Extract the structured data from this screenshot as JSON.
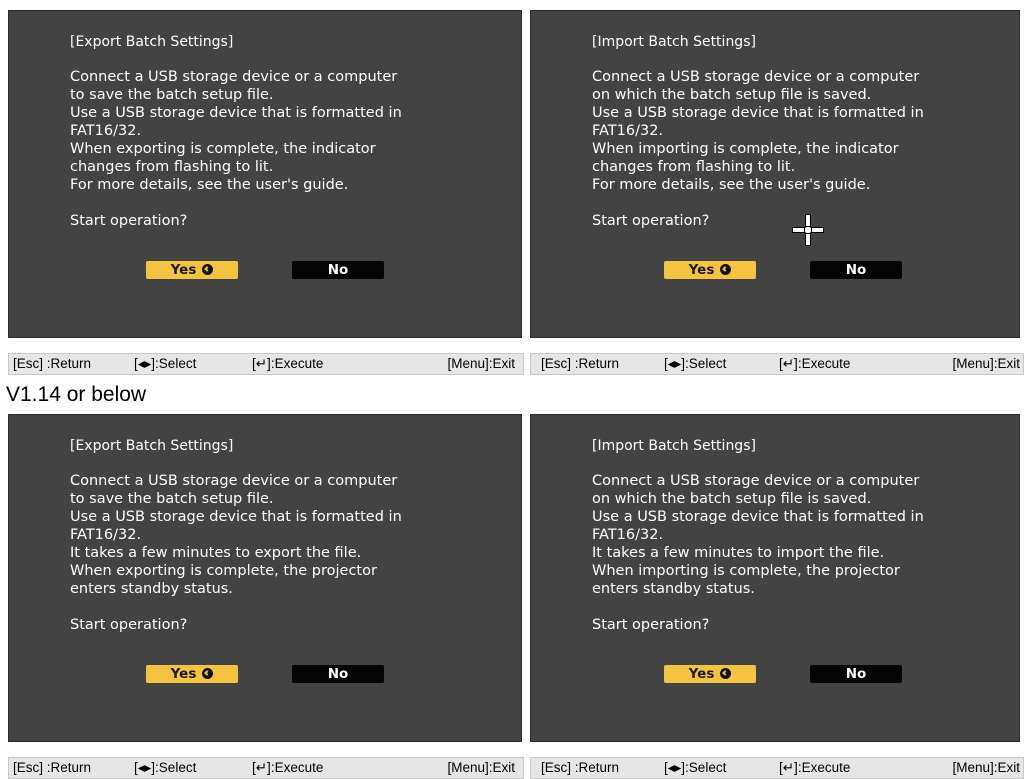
{
  "version_label": "V1.14 or below",
  "panels": {
    "top_left": {
      "title": "[Export Batch Settings]",
      "lines": [
        "Connect a USB storage device or a computer",
        "to save the batch setup file.",
        "Use a USB storage device that is formatted in",
        "FAT16/32.",
        "When exporting is complete, the indicator",
        "changes from flashing to lit.",
        "For more details, see the user's guide."
      ],
      "prompt": "Start operation?",
      "yes": "Yes",
      "no": "No"
    },
    "top_right": {
      "title": "[Import Batch Settings]",
      "lines": [
        "Connect a USB storage device or a computer",
        "on which the batch setup file is saved.",
        "Use a USB storage device that is formatted in",
        "FAT16/32.",
        "When importing is complete, the indicator",
        "changes from flashing to lit.",
        "For more details, see the user's guide."
      ],
      "prompt": "Start operation?",
      "yes": "Yes",
      "no": "No"
    },
    "bottom_left": {
      "title": "[Export Batch Settings]",
      "lines": [
        "Connect a USB storage device or a computer",
        "to save the batch setup file.",
        "Use a USB storage device that is formatted in",
        "FAT16/32.",
        "It takes a few minutes to export the file.",
        "When exporting is complete, the projector",
        "enters standby status."
      ],
      "prompt": "Start operation?",
      "yes": "Yes",
      "no": "No"
    },
    "bottom_right": {
      "title": "[Import Batch Settings]",
      "lines": [
        "Connect a USB storage device or a computer",
        "on which the batch setup file is saved.",
        "Use a USB storage device that is formatted in",
        "FAT16/32.",
        "It takes a few minutes to import the file.",
        "When importing is complete, the projector",
        "enters standby status."
      ],
      "prompt": "Start operation?",
      "yes": "Yes",
      "no": "No"
    }
  },
  "status_bar": {
    "return_hint": "[Esc] :Return",
    "select_hint": "[◂▸]:Select",
    "execute_hint": "[↵]:Execute",
    "exit_hint": "[Menu]:Exit"
  },
  "colors": {
    "panel_bg": "#434343",
    "yes_button": "#f5c342",
    "no_button": "#050505",
    "status_bg": "#e6e6e6"
  },
  "icons": {
    "enter": "enter-icon",
    "cursor": "crosshair-cursor-icon"
  }
}
